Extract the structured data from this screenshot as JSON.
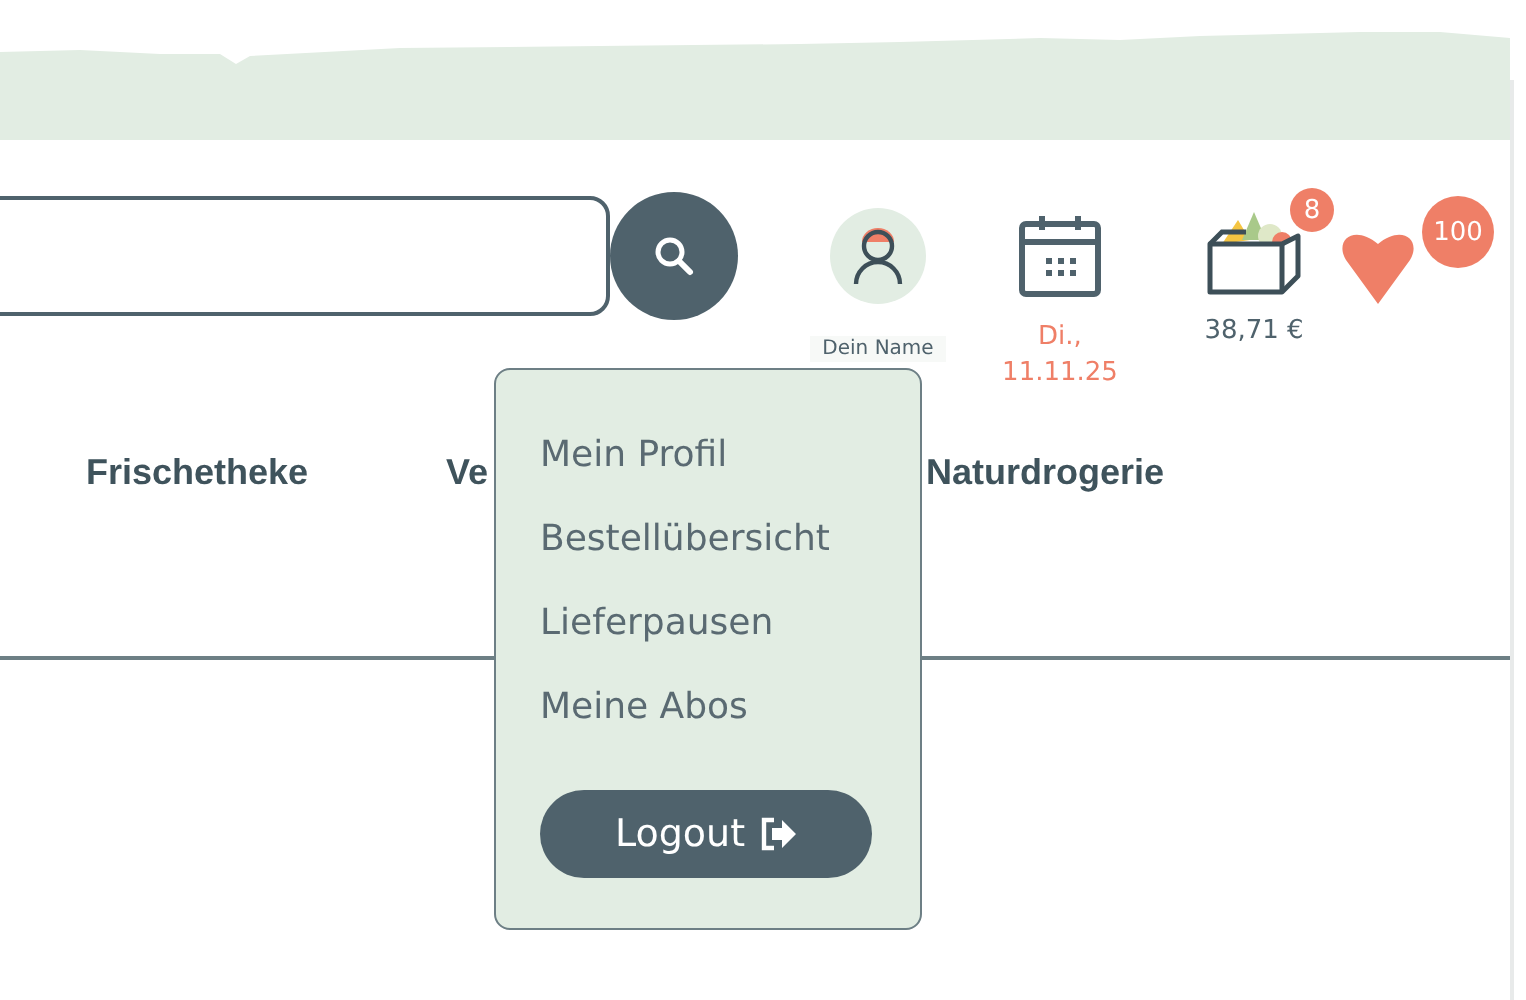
{
  "header": {
    "user": {
      "name": "Dein Name"
    },
    "delivery": {
      "date": "Di., 11.11.25"
    },
    "cart": {
      "count": "8",
      "total": "38,71 €"
    },
    "favorites": {
      "count": "100"
    }
  },
  "nav": [
    {
      "label": "Frischetheke"
    },
    {
      "label": "Ve"
    },
    {
      "label": "Naturdrogerie"
    }
  ],
  "user_menu": {
    "items": [
      {
        "label": "Mein Profil"
      },
      {
        "label": "Bestellübersicht"
      },
      {
        "label": "Lieferpausen"
      },
      {
        "label": "Meine Abos"
      }
    ],
    "logout": "Logout"
  }
}
